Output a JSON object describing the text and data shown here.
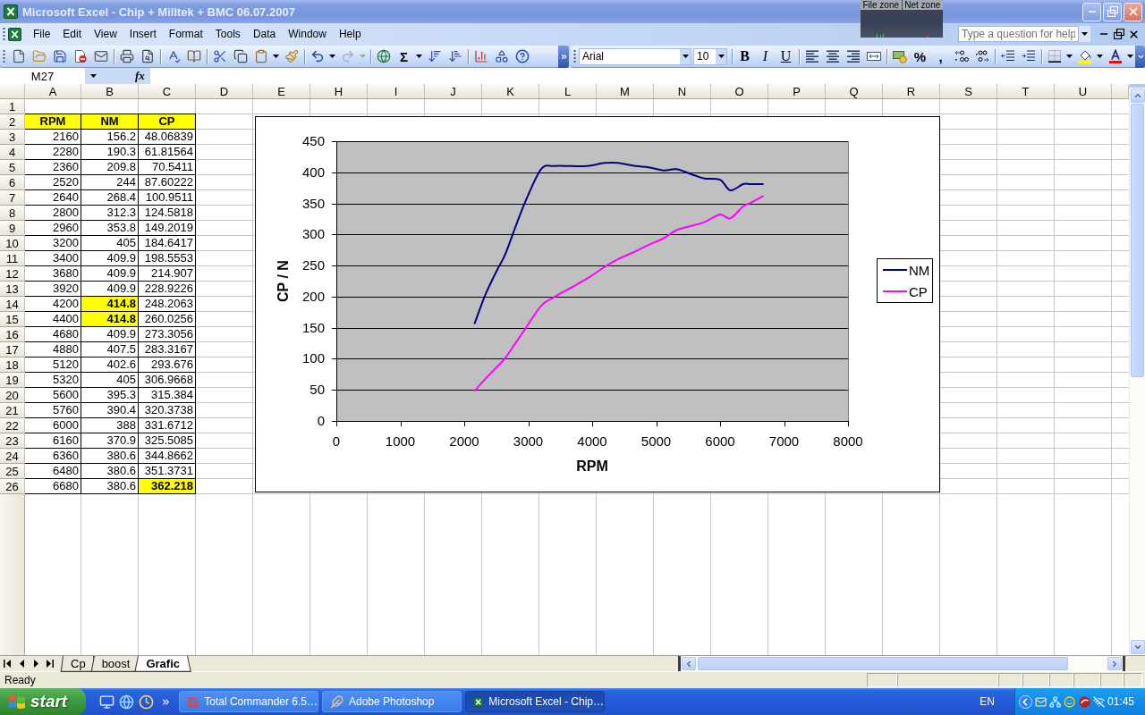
{
  "window": {
    "title": "Microsoft Excel - Chip + Milltek + BMC 06.07.2007"
  },
  "monitor_widget": {
    "labels": [
      "File zone",
      "Net zone"
    ]
  },
  "menu": [
    "File",
    "Edit",
    "View",
    "Insert",
    "Format",
    "Tools",
    "Data",
    "Window",
    "Help"
  ],
  "help_search": {
    "placeholder": "Type a question for help"
  },
  "standard_toolbar": {
    "autosum_label": "Σ",
    "redo": {
      "disabled": true
    }
  },
  "formatting_toolbar": {
    "font": "Arial",
    "font_size": "10",
    "style_buttons": [
      {
        "kind": "bold",
        "label": "B"
      },
      {
        "kind": "italic",
        "label": "I"
      },
      {
        "kind": "underline",
        "label": "U"
      }
    ],
    "percent_label": "%",
    "comma_label": ","
  },
  "formula_bar": {
    "name_box": "M27",
    "function_label": "fx"
  },
  "sheet": {
    "columns": [
      "A",
      "B",
      "C",
      "D",
      "E",
      "H",
      "I",
      "J",
      "K",
      "L",
      "M",
      "N",
      "O",
      "P",
      "Q",
      "R",
      "S",
      "T",
      "U"
    ],
    "rows": [
      {
        "number": "1"
      },
      {
        "number": "2",
        "kind": "header",
        "cells": [
          {
            "text": "RPM",
            "highlighted": true
          },
          {
            "text": "NM",
            "highlighted": true
          },
          {
            "text": "CP",
            "highlighted": true
          }
        ]
      },
      {
        "number": "3",
        "kind": "data",
        "cells": [
          {
            "text": "2160",
            "highlighted": false
          },
          {
            "text": "156.2",
            "highlighted": false
          },
          {
            "text": "48.06839",
            "highlighted": false
          }
        ]
      },
      {
        "number": "4",
        "kind": "data",
        "cells": [
          {
            "text": "2280",
            "highlighted": false
          },
          {
            "text": "190.3",
            "highlighted": false
          },
          {
            "text": "61.81564",
            "highlighted": false
          }
        ]
      },
      {
        "number": "5",
        "kind": "data",
        "cells": [
          {
            "text": "2360",
            "highlighted": false
          },
          {
            "text": "209.8",
            "highlighted": false
          },
          {
            "text": "70.5411",
            "highlighted": false
          }
        ]
      },
      {
        "number": "6",
        "kind": "data",
        "cells": [
          {
            "text": "2520",
            "highlighted": false
          },
          {
            "text": "244",
            "highlighted": false
          },
          {
            "text": "87.60222",
            "highlighted": false
          }
        ]
      },
      {
        "number": "7",
        "kind": "data",
        "cells": [
          {
            "text": "2640",
            "highlighted": false
          },
          {
            "text": "268.4",
            "highlighted": false
          },
          {
            "text": "100.9511",
            "highlighted": false
          }
        ]
      },
      {
        "number": "8",
        "kind": "data",
        "cells": [
          {
            "text": "2800",
            "highlighted": false
          },
          {
            "text": "312.3",
            "highlighted": false
          },
          {
            "text": "124.5818",
            "highlighted": false
          }
        ]
      },
      {
        "number": "9",
        "kind": "data",
        "cells": [
          {
            "text": "2960",
            "highlighted": false
          },
          {
            "text": "353.8",
            "highlighted": false
          },
          {
            "text": "149.2019",
            "highlighted": false
          }
        ]
      },
      {
        "number": "10",
        "kind": "data",
        "cells": [
          {
            "text": "3200",
            "highlighted": false
          },
          {
            "text": "405",
            "highlighted": false
          },
          {
            "text": "184.6417",
            "highlighted": false
          }
        ]
      },
      {
        "number": "11",
        "kind": "data",
        "cells": [
          {
            "text": "3400",
            "highlighted": false
          },
          {
            "text": "409.9",
            "highlighted": false
          },
          {
            "text": "198.5553",
            "highlighted": false
          }
        ]
      },
      {
        "number": "12",
        "kind": "data",
        "cells": [
          {
            "text": "3680",
            "highlighted": false
          },
          {
            "text": "409.9",
            "highlighted": false
          },
          {
            "text": "214.907",
            "highlighted": false
          }
        ]
      },
      {
        "number": "13",
        "kind": "data",
        "cells": [
          {
            "text": "3920",
            "highlighted": false
          },
          {
            "text": "409.9",
            "highlighted": false
          },
          {
            "text": "228.9226",
            "highlighted": false
          }
        ]
      },
      {
        "number": "14",
        "kind": "data",
        "cells": [
          {
            "text": "4200",
            "highlighted": false
          },
          {
            "text": "414.8",
            "highlighted": true
          },
          {
            "text": "248.2063",
            "highlighted": false
          }
        ]
      },
      {
        "number": "15",
        "kind": "data",
        "cells": [
          {
            "text": "4400",
            "highlighted": false
          },
          {
            "text": "414.8",
            "highlighted": true
          },
          {
            "text": "260.0256",
            "highlighted": false
          }
        ]
      },
      {
        "number": "16",
        "kind": "data",
        "cells": [
          {
            "text": "4680",
            "highlighted": false
          },
          {
            "text": "409.9",
            "highlighted": false
          },
          {
            "text": "273.3056",
            "highlighted": false
          }
        ]
      },
      {
        "number": "17",
        "kind": "data",
        "cells": [
          {
            "text": "4880",
            "highlighted": false
          },
          {
            "text": "407.5",
            "highlighted": false
          },
          {
            "text": "283.3167",
            "highlighted": false
          }
        ]
      },
      {
        "number": "18",
        "kind": "data",
        "cells": [
          {
            "text": "5120",
            "highlighted": false
          },
          {
            "text": "402.6",
            "highlighted": false
          },
          {
            "text": "293.676",
            "highlighted": false
          }
        ]
      },
      {
        "number": "19",
        "kind": "data",
        "cells": [
          {
            "text": "5320",
            "highlighted": false
          },
          {
            "text": "405",
            "highlighted": false
          },
          {
            "text": "306.9668",
            "highlighted": false
          }
        ]
      },
      {
        "number": "20",
        "kind": "data",
        "cells": [
          {
            "text": "5600",
            "highlighted": false
          },
          {
            "text": "395.3",
            "highlighted": false
          },
          {
            "text": "315.384",
            "highlighted": false
          }
        ]
      },
      {
        "number": "21",
        "kind": "data",
        "cells": [
          {
            "text": "5760",
            "highlighted": false
          },
          {
            "text": "390.4",
            "highlighted": false
          },
          {
            "text": "320.3738",
            "highlighted": false
          }
        ]
      },
      {
        "number": "22",
        "kind": "data",
        "cells": [
          {
            "text": "6000",
            "highlighted": false
          },
          {
            "text": "388",
            "highlighted": false
          },
          {
            "text": "331.6712",
            "highlighted": false
          }
        ]
      },
      {
        "number": "23",
        "kind": "data",
        "cells": [
          {
            "text": "6160",
            "highlighted": false
          },
          {
            "text": "370.9",
            "highlighted": false
          },
          {
            "text": "325.5085",
            "highlighted": false
          }
        ]
      },
      {
        "number": "24",
        "kind": "data",
        "cells": [
          {
            "text": "6360",
            "highlighted": false
          },
          {
            "text": "380.6",
            "highlighted": false
          },
          {
            "text": "344.8662",
            "highlighted": false
          }
        ]
      },
      {
        "number": "25",
        "kind": "data",
        "cells": [
          {
            "text": "6480",
            "highlighted": false
          },
          {
            "text": "380.6",
            "highlighted": false
          },
          {
            "text": "351.3731",
            "highlighted": false
          }
        ]
      },
      {
        "number": "26",
        "kind": "data",
        "cells": [
          {
            "text": "6680",
            "highlighted": false
          },
          {
            "text": "380.6",
            "highlighted": false
          },
          {
            "text": "362.218",
            "highlighted": true
          }
        ]
      }
    ]
  },
  "chart": {
    "chart_data": {
      "type": "line",
      "xlabel": "RPM",
      "ylabel": "CP / N",
      "x": [
        2160,
        2280,
        2360,
        2520,
        2640,
        2800,
        2960,
        3200,
        3400,
        3680,
        3920,
        4200,
        4400,
        4680,
        4880,
        5120,
        5320,
        5600,
        5760,
        6000,
        6160,
        6360,
        6480,
        6680
      ],
      "series": [
        {
          "name": "NM",
          "color": "#000080",
          "values": [
            156,
            190,
            210,
            244,
            268,
            312,
            354,
            405,
            410,
            410,
            410,
            415,
            415,
            410,
            408,
            403,
            405,
            395,
            390,
            388,
            371,
            381,
            381,
            381
          ]
        },
        {
          "name": "CP",
          "color": "#ff00ff",
          "values": [
            48,
            62,
            71,
            88,
            101,
            125,
            149,
            185,
            199,
            215,
            229,
            248,
            260,
            273,
            283,
            294,
            307,
            315,
            320,
            332,
            326,
            345,
            351,
            362
          ]
        }
      ],
      "xlim": [
        0,
        8000
      ],
      "ylim": [
        0,
        450
      ],
      "xticks": [
        {
          "value": 0,
          "label": "0"
        },
        {
          "value": 1000,
          "label": "1000"
        },
        {
          "value": 2000,
          "label": "2000"
        },
        {
          "value": 3000,
          "label": "3000"
        },
        {
          "value": 4000,
          "label": "4000"
        },
        {
          "value": 5000,
          "label": "5000"
        },
        {
          "value": 6000,
          "label": "6000"
        },
        {
          "value": 7000,
          "label": "7000"
        },
        {
          "value": 8000,
          "label": "8000"
        }
      ],
      "yticks": [
        0,
        50,
        100,
        150,
        200,
        250,
        300,
        350,
        400,
        450
      ],
      "grid": true,
      "legend": "right"
    }
  },
  "sheet_tabs": [
    {
      "label": "Cp",
      "selected": false
    },
    {
      "label": "boost",
      "selected": false
    },
    {
      "label": "Grafic",
      "selected": true
    }
  ],
  "status_bar": {
    "text": "Ready"
  },
  "taskbar": {
    "start_label": "start",
    "tasks": [
      {
        "label": "Total Commander 6.5…",
        "selected": false
      },
      {
        "label": "Adobe Photoshop",
        "selected": false
      },
      {
        "label": "Microsoft Excel - Chip…",
        "selected": true
      }
    ],
    "language": "EN",
    "clock": "01:45"
  }
}
